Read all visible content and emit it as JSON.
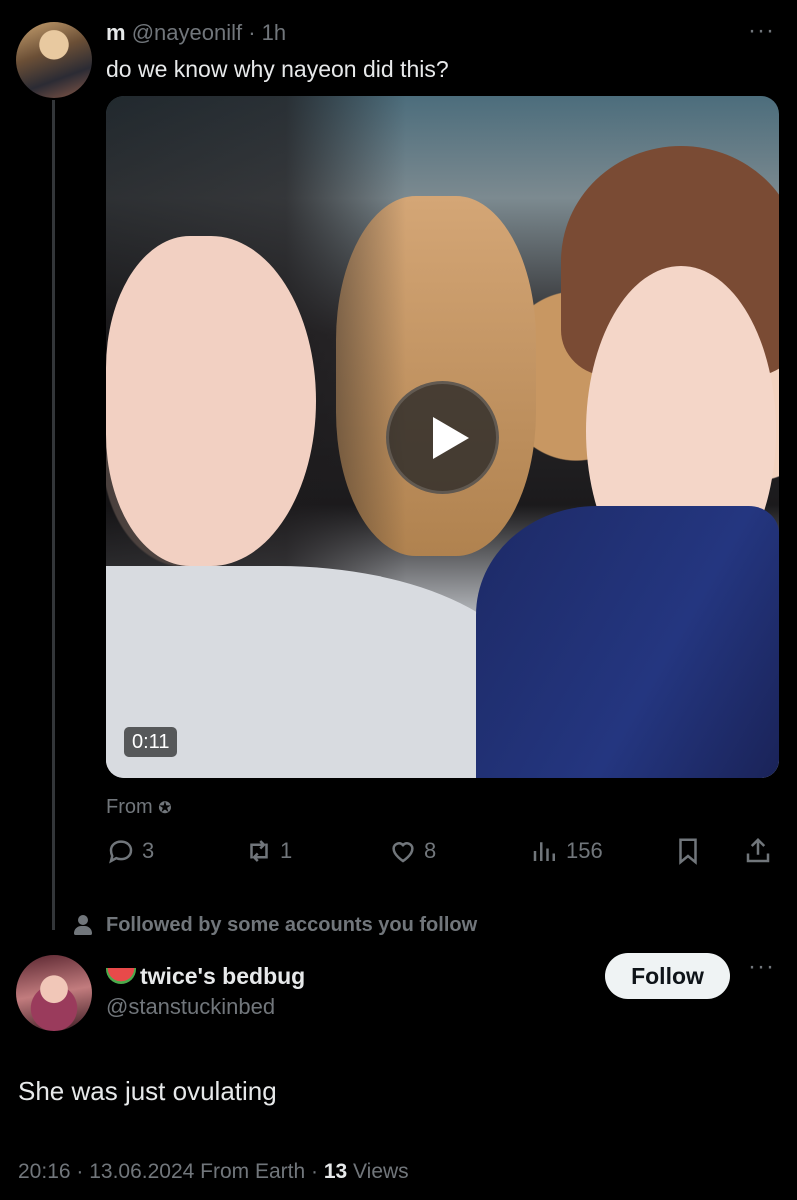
{
  "post": {
    "display_name": "m",
    "handle": "@nayeonilf",
    "separator": "·",
    "time": "1h",
    "text": "do we know why nayeon did this?",
    "video_duration": "0:11",
    "from_label": "From",
    "more_icon": "more-dots-icon",
    "stats": {
      "replies": "3",
      "reposts": "1",
      "likes": "8",
      "views": "156"
    }
  },
  "followed_notice": "Followed by some accounts you follow",
  "reply": {
    "display_name": "twice's bedbug",
    "emoji_icon": "watermelon-icon",
    "handle": "@stanstuckinbed",
    "follow_label": "Follow",
    "text": "She was just ovulating",
    "meta_prefix": "20:16 · 13.06.2024 From Earth · ",
    "views_count": "13",
    "views_label": " Views"
  },
  "colors": {
    "background": "#000000",
    "text_primary": "#e7e9ea",
    "text_secondary": "#71767b",
    "button_bg": "#eff3f4"
  }
}
